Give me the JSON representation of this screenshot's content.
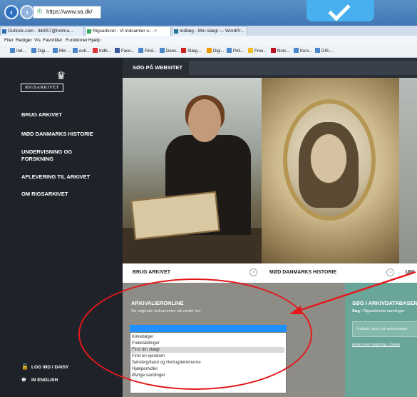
{
  "browser": {
    "url": "https://www.sa.dk/",
    "tabs": [
      {
        "label": "Outlook.com - lkb057@hotma...",
        "active": false
      },
      {
        "label": "Rigsarkivet - Vi indsamler o... ×",
        "active": true
      },
      {
        "label": "Indlæg - Min slægt — WordPr...",
        "active": false
      }
    ],
    "menu": [
      "Filer",
      "Rediger",
      "Vis",
      "Favoritter",
      "Funktioner",
      "Hjælp"
    ],
    "favorites": [
      "Ind...",
      "Digi...",
      "Min ...",
      "outl...",
      "Indb...",
      "Face...",
      "Find...",
      "Dans...",
      "Slæg...",
      "Digi...",
      "Poli...",
      "Free...",
      "Nors...",
      "Kurs...",
      "DIS-..."
    ]
  },
  "site": {
    "logo_text": "RIGSARKIVET",
    "search_label": "SØG PÅ WEBSITET",
    "menu": [
      "BRUG ARKIVET",
      "MØD DANMARKS HISTORIE",
      "UNDERVISNING OG FORSKNING",
      "AFLEVERING TIL ARKIVET",
      "OM RIGSARKIVET"
    ],
    "bottom_links": [
      {
        "label": "LOG IND I DAISY",
        "icon": "lock-icon"
      },
      {
        "label": "IN ENGLISH",
        "icon": "globe-icon"
      }
    ],
    "sections": [
      "BRUG ARKIVET",
      "MØD DANMARKS HISTORIE",
      "UNI"
    ],
    "arkivalieronline": {
      "title": "ARKIVALIERONLINE",
      "subtitle": "Se originale dokumenter på nettet her:",
      "options": [
        "Kirkebøger",
        "Folketællinger",
        "Find din slægt",
        "Find en ejendom",
        "Sønderjylland og Hertugdømmerne",
        "Hjælpemidler",
        "Øvrige samlinger"
      ],
      "selected_index": 2
    },
    "arkivdatabase": {
      "title": "SØG I ARKIVDATABASEN",
      "subtitle_bold": "Søg",
      "subtitle_rest": " i Rigsarkivets samlinger",
      "placeholder": "Indtast navn på arkivskaber",
      "link": "Avanceret søgning i Daisy"
    }
  },
  "colors": {
    "accent_red": "#e3181c",
    "dropdown_blue": "#1e90ff",
    "sidebar": "#1f2329",
    "teal_panel": "#6aa59a"
  }
}
